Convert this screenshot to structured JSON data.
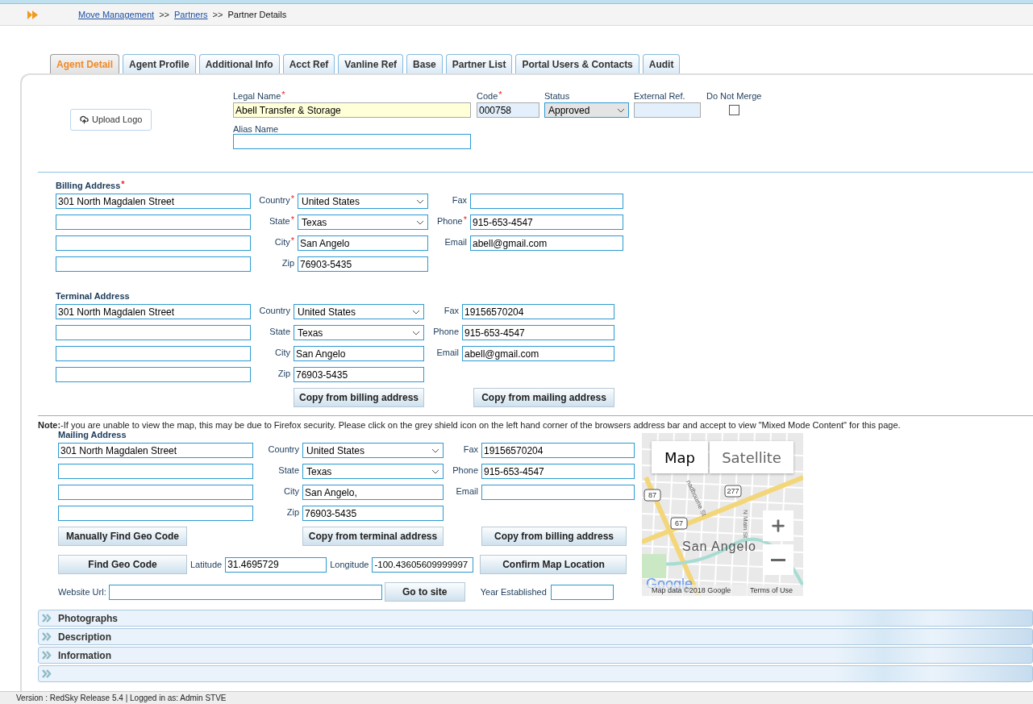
{
  "required_mark": "*",
  "breadcrumb": {
    "separator": ">>",
    "items": [
      {
        "label": "Move Management",
        "kind": "link"
      },
      {
        "label": "Partners",
        "kind": "link"
      },
      {
        "label": "Partner Details",
        "kind": "current"
      }
    ]
  },
  "tabs": [
    {
      "label": "Agent Detail",
      "selected": true
    },
    {
      "label": "Agent Profile",
      "selected": false
    },
    {
      "label": "Additional Info",
      "selected": false
    },
    {
      "label": "Acct Ref",
      "selected": false
    },
    {
      "label": "Vanline Ref",
      "selected": false
    },
    {
      "label": "Base",
      "selected": false
    },
    {
      "label": "Partner List",
      "selected": false
    },
    {
      "label": "Portal Users & Contacts",
      "selected": false
    },
    {
      "label": "Audit",
      "selected": false
    }
  ],
  "header": {
    "upload_button": "Upload Logo",
    "legal_name": {
      "label": "Legal Name",
      "required": true,
      "value": "Abell Transfer & Storage"
    },
    "code": {
      "label": "Code",
      "required": true,
      "value": "000758"
    },
    "status": {
      "label": "Status",
      "value": "Approved"
    },
    "external_ref": {
      "label": "External Ref."
    },
    "do_not_merge": {
      "label": "Do Not Merge",
      "checked": false
    },
    "alias_name": {
      "label": "Alias Name"
    }
  },
  "addresses": [
    {
      "title": "Billing Address",
      "required": true,
      "street": [
        "301 North Magdalen Street"
      ],
      "fields": [
        {
          "label": "Country",
          "required": true,
          "kind": "select",
          "value": "United States"
        },
        {
          "label": "State",
          "required": true,
          "kind": "select",
          "value": "Texas"
        },
        {
          "label": "City",
          "required": true,
          "kind": "input",
          "value": "San Angelo"
        },
        {
          "label": "Zip",
          "required": false,
          "kind": "input",
          "value": "76903-5435"
        }
      ],
      "contact": [
        {
          "label": "Fax",
          "required": false
        },
        {
          "label": "Phone",
          "required": true,
          "value": "915-653-4547"
        },
        {
          "label": "Email",
          "required": false,
          "value": "abell@gmail.com"
        }
      ]
    },
    {
      "title": "Terminal Address",
      "required": false,
      "street": [
        "301 North Magdalen Street"
      ],
      "fields": [
        {
          "label": "Country",
          "required": false,
          "kind": "select",
          "value": "United States"
        },
        {
          "label": "State",
          "required": false,
          "kind": "select",
          "value": "Texas"
        },
        {
          "label": "City",
          "required": false,
          "kind": "input",
          "value": "San Angelo"
        },
        {
          "label": "Zip",
          "required": false,
          "kind": "input",
          "value": "76903-5435"
        }
      ],
      "contact": [
        {
          "label": "Fax",
          "required": false,
          "value": "19156570204"
        },
        {
          "label": "Phone",
          "required": false,
          "value": "915-653-4547"
        },
        {
          "label": "Email",
          "required": false,
          "value": "abell@gmail.com"
        }
      ],
      "buttons": [
        {
          "label": "Copy from billing address",
          "kind": "copy"
        },
        {
          "label": "Copy from mailing address",
          "kind": "copy"
        }
      ]
    },
    {
      "title": "Mailing Address",
      "required": false,
      "street": [
        "301 North Magdalen Street"
      ],
      "fields": [
        {
          "label": "Country",
          "required": false,
          "kind": "select",
          "value": "United States"
        },
        {
          "label": "State",
          "required": false,
          "kind": "select",
          "value": "Texas"
        },
        {
          "label": "City",
          "required": false,
          "kind": "input",
          "value": "San Angelo,"
        },
        {
          "label": "Zip",
          "required": false,
          "kind": "input",
          "value": "76903-5435"
        }
      ],
      "contact": [
        {
          "label": "Fax",
          "required": false,
          "value": "19156570204"
        },
        {
          "label": "Phone",
          "required": false,
          "value": "915-653-4547"
        },
        {
          "label": "Email",
          "required": false
        }
      ],
      "buttons": [
        {
          "label": "Manually Find Geo Code",
          "kind": "geo"
        },
        {
          "label": "Copy from terminal address",
          "kind": "copy"
        },
        {
          "label": "Copy from billing address",
          "kind": "copy"
        }
      ]
    }
  ],
  "note": "**Note:**-If you are unable to view the map, this may be due to Firefox security. Please click on the grey shield icon on the left hand corner of the browsers address bar and accept to view \"Mixed Mode Content\" for this page.",
  "geo": {
    "find_button": "Find Geo Code",
    "latitude": {
      "label": "Latitude",
      "value": "31.4695729"
    },
    "longitude": {
      "label": "Longitude",
      "value": "-100.43605609999997"
    },
    "confirm_button": "Confirm Map Location"
  },
  "website": {
    "label": "Website Url:",
    "go_button": "Go to site",
    "year_label": "Year Established"
  },
  "map": {
    "map_button": "Map",
    "satellite_button": "Satellite",
    "place": "San Angelo",
    "routes": [
      "87",
      "277",
      "67"
    ],
    "streets": [
      "nadbourne St",
      "N Main St"
    ],
    "logo": "Google",
    "attribution": "Map data ©2018 Google",
    "terms": "Terms of Use"
  },
  "accordions": [
    {
      "label": "Photographs",
      "expanded": false
    },
    {
      "label": "Description",
      "expanded": false
    },
    {
      "label": "Information",
      "expanded": false
    },
    {
      "expanded": false
    }
  ],
  "status_bar": "Version : RedSky Release 5.4 | Logged in as: Admin STVE"
}
